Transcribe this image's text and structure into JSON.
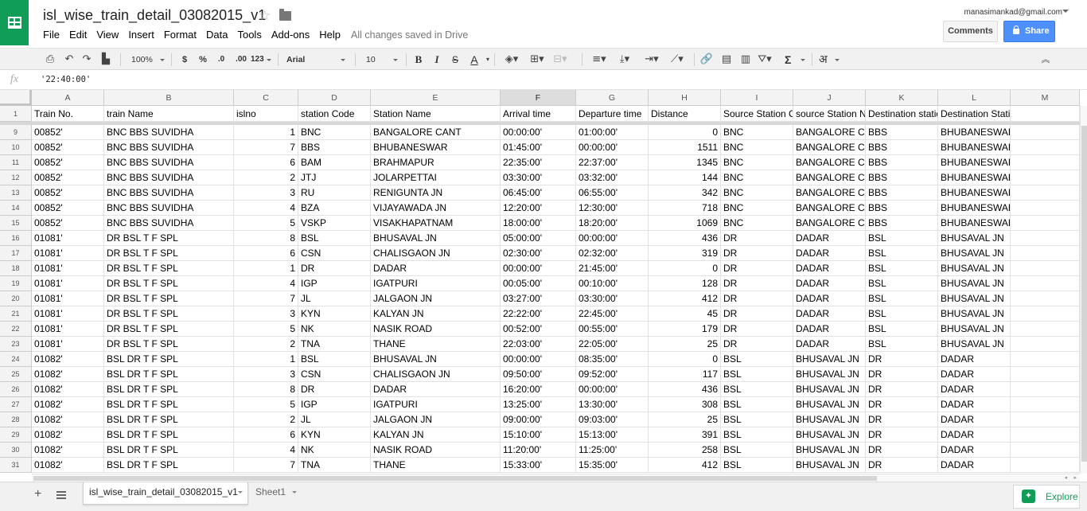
{
  "doc": {
    "title": "isl_wise_train_detail_03082015_v1",
    "save_status": "All changes saved in Drive"
  },
  "menu": [
    "File",
    "Edit",
    "View",
    "Insert",
    "Format",
    "Data",
    "Tools",
    "Add-ons",
    "Help"
  ],
  "account": {
    "email": "manasimankad@gmail.com"
  },
  "buttons": {
    "comments": "Comments",
    "share": "Share",
    "explore": "Explore"
  },
  "toolbar": {
    "zoom": "100%",
    "currency": "$",
    "percent": "%",
    "dec_decrease": ".0",
    "dec_increase": ".00",
    "more_formats": "123",
    "font": "Arial",
    "font_size": "10",
    "bold": "B",
    "italic": "I",
    "strikethrough": "S",
    "text_color": "A",
    "functions": "Σ",
    "input_tools": "अ"
  },
  "formula": {
    "fx": "fx",
    "value": "'22:40:00'"
  },
  "columns": [
    "A",
    "B",
    "C",
    "D",
    "E",
    "F",
    "G",
    "H",
    "I",
    "J",
    "K",
    "L",
    "M"
  ],
  "selected_column": "F",
  "header_row": {
    "num": "1",
    "cells": [
      "Train No.",
      "train Name",
      "islno",
      "station Code",
      "Station Name",
      "Arrival time",
      "Departure time",
      "Distance",
      "Source Station C",
      "source Station Na",
      "Destination statio",
      "Destination Station Name",
      ""
    ]
  },
  "rows": [
    {
      "num": "9",
      "cells": [
        "00852'",
        "BNC BBS SUVIDHA",
        "1",
        "BNC",
        "BANGALORE CANT",
        "00:00:00'",
        "01:00:00'",
        "0",
        "BNC",
        "BANGALORE C/",
        "BBS",
        "BHUBANESWAR",
        ""
      ]
    },
    {
      "num": "10",
      "cells": [
        "00852'",
        "BNC BBS SUVIDHA",
        "7",
        "BBS",
        "BHUBANESWAR",
        "01:45:00'",
        "00:00:00'",
        "1511",
        "BNC",
        "BANGALORE C/",
        "BBS",
        "BHUBANESWAR",
        ""
      ]
    },
    {
      "num": "11",
      "cells": [
        "00852'",
        "BNC BBS SUVIDHA",
        "6",
        "BAM",
        "BRAHMAPUR",
        "22:35:00'",
        "22:37:00'",
        "1345",
        "BNC",
        "BANGALORE C/",
        "BBS",
        "BHUBANESWAR",
        ""
      ]
    },
    {
      "num": "12",
      "cells": [
        "00852'",
        "BNC BBS SUVIDHA",
        "2",
        "JTJ",
        "JOLARPETTAI",
        "03:30:00'",
        "03:32:00'",
        "144",
        "BNC",
        "BANGALORE C/",
        "BBS",
        "BHUBANESWAR",
        ""
      ]
    },
    {
      "num": "13",
      "cells": [
        "00852'",
        "BNC BBS SUVIDHA",
        "3",
        "RU",
        "RENIGUNTA JN",
        "06:45:00'",
        "06:55:00'",
        "342",
        "BNC",
        "BANGALORE C/",
        "BBS",
        "BHUBANESWAR",
        ""
      ]
    },
    {
      "num": "14",
      "cells": [
        "00852'",
        "BNC BBS SUVIDHA",
        "4",
        "BZA",
        "VIJAYAWADA JN",
        "12:20:00'",
        "12:30:00'",
        "718",
        "BNC",
        "BANGALORE C/",
        "BBS",
        "BHUBANESWAR",
        ""
      ]
    },
    {
      "num": "15",
      "cells": [
        "00852'",
        "BNC BBS SUVIDHA",
        "5",
        "VSKP",
        "VISAKHAPATNAM",
        "18:00:00'",
        "18:20:00'",
        "1069",
        "BNC",
        "BANGALORE C/",
        "BBS",
        "BHUBANESWAR",
        ""
      ]
    },
    {
      "num": "16",
      "cells": [
        "01081'",
        "DR BSL T F SPL",
        "8",
        "BSL",
        "BHUSAVAL JN",
        "05:00:00'",
        "00:00:00'",
        "436",
        "DR",
        "DADAR",
        "BSL",
        "BHUSAVAL JN",
        ""
      ]
    },
    {
      "num": "17",
      "cells": [
        "01081'",
        "DR BSL T F SPL",
        "6",
        "CSN",
        "CHALISGAON JN",
        "02:30:00'",
        "02:32:00'",
        "319",
        "DR",
        "DADAR",
        "BSL",
        "BHUSAVAL JN",
        ""
      ]
    },
    {
      "num": "18",
      "cells": [
        "01081'",
        "DR BSL T F SPL",
        "1",
        "DR",
        "DADAR",
        "00:00:00'",
        "21:45:00'",
        "0",
        "DR",
        "DADAR",
        "BSL",
        "BHUSAVAL JN",
        ""
      ]
    },
    {
      "num": "19",
      "cells": [
        "01081'",
        "DR BSL T F SPL",
        "4",
        "IGP",
        "IGATPURI",
        "00:05:00'",
        "00:10:00'",
        "128",
        "DR",
        "DADAR",
        "BSL",
        "BHUSAVAL JN",
        ""
      ]
    },
    {
      "num": "20",
      "cells": [
        "01081'",
        "DR BSL T F SPL",
        "7",
        "JL",
        "JALGAON JN",
        "03:27:00'",
        "03:30:00'",
        "412",
        "DR",
        "DADAR",
        "BSL",
        "BHUSAVAL JN",
        ""
      ]
    },
    {
      "num": "21",
      "cells": [
        "01081'",
        "DR BSL T F SPL",
        "3",
        "KYN",
        "KALYAN JN",
        "22:22:00'",
        "22:45:00'",
        "45",
        "DR",
        "DADAR",
        "BSL",
        "BHUSAVAL JN",
        ""
      ]
    },
    {
      "num": "22",
      "cells": [
        "01081'",
        "DR BSL T F SPL",
        "5",
        "NK",
        "NASIK ROAD",
        "00:52:00'",
        "00:55:00'",
        "179",
        "DR",
        "DADAR",
        "BSL",
        "BHUSAVAL JN",
        ""
      ]
    },
    {
      "num": "23",
      "cells": [
        "01081'",
        "DR BSL T F SPL",
        "2",
        "TNA",
        "THANE",
        "22:03:00'",
        "22:05:00'",
        "25",
        "DR",
        "DADAR",
        "BSL",
        "BHUSAVAL JN",
        ""
      ]
    },
    {
      "num": "24",
      "cells": [
        "01082'",
        "BSL DR T F SPL",
        "1",
        "BSL",
        "BHUSAVAL JN",
        "00:00:00'",
        "08:35:00'",
        "0",
        "BSL",
        "BHUSAVAL JN",
        "DR",
        "DADAR",
        ""
      ]
    },
    {
      "num": "25",
      "cells": [
        "01082'",
        "BSL DR T F SPL",
        "3",
        "CSN",
        "CHALISGAON JN",
        "09:50:00'",
        "09:52:00'",
        "117",
        "BSL",
        "BHUSAVAL JN",
        "DR",
        "DADAR",
        ""
      ]
    },
    {
      "num": "26",
      "cells": [
        "01082'",
        "BSL DR T F SPL",
        "8",
        "DR",
        "DADAR",
        "16:20:00'",
        "00:00:00'",
        "436",
        "BSL",
        "BHUSAVAL JN",
        "DR",
        "DADAR",
        ""
      ]
    },
    {
      "num": "27",
      "cells": [
        "01082'",
        "BSL DR T F SPL",
        "5",
        "IGP",
        "IGATPURI",
        "13:25:00'",
        "13:30:00'",
        "308",
        "BSL",
        "BHUSAVAL JN",
        "DR",
        "DADAR",
        ""
      ]
    },
    {
      "num": "28",
      "cells": [
        "01082'",
        "BSL DR T F SPL",
        "2",
        "JL",
        "JALGAON JN",
        "09:00:00'",
        "09:03:00'",
        "25",
        "BSL",
        "BHUSAVAL JN",
        "DR",
        "DADAR",
        ""
      ]
    },
    {
      "num": "29",
      "cells": [
        "01082'",
        "BSL DR T F SPL",
        "6",
        "KYN",
        "KALYAN JN",
        "15:10:00'",
        "15:13:00'",
        "391",
        "BSL",
        "BHUSAVAL JN",
        "DR",
        "DADAR",
        ""
      ]
    },
    {
      "num": "30",
      "cells": [
        "01082'",
        "BSL DR T F SPL",
        "4",
        "NK",
        "NASIK ROAD",
        "11:20:00'",
        "11:25:00'",
        "258",
        "BSL",
        "BHUSAVAL JN",
        "DR",
        "DADAR",
        ""
      ]
    },
    {
      "num": "31",
      "cells": [
        "01082'",
        "BSL DR T F SPL",
        "7",
        "TNA",
        "THANE",
        "15:33:00'",
        "15:35:00'",
        "412",
        "BSL",
        "BHUSAVAL JN",
        "DR",
        "DADAR",
        ""
      ]
    }
  ],
  "numeric_columns": [
    2,
    7
  ],
  "sheets": [
    {
      "label": "isl_wise_train_detail_03082015_v1",
      "active": true
    },
    {
      "label": "Sheet1",
      "active": false
    }
  ],
  "colors": {
    "brand_green": "#0f9d58",
    "share_blue": "#4d90fe"
  }
}
